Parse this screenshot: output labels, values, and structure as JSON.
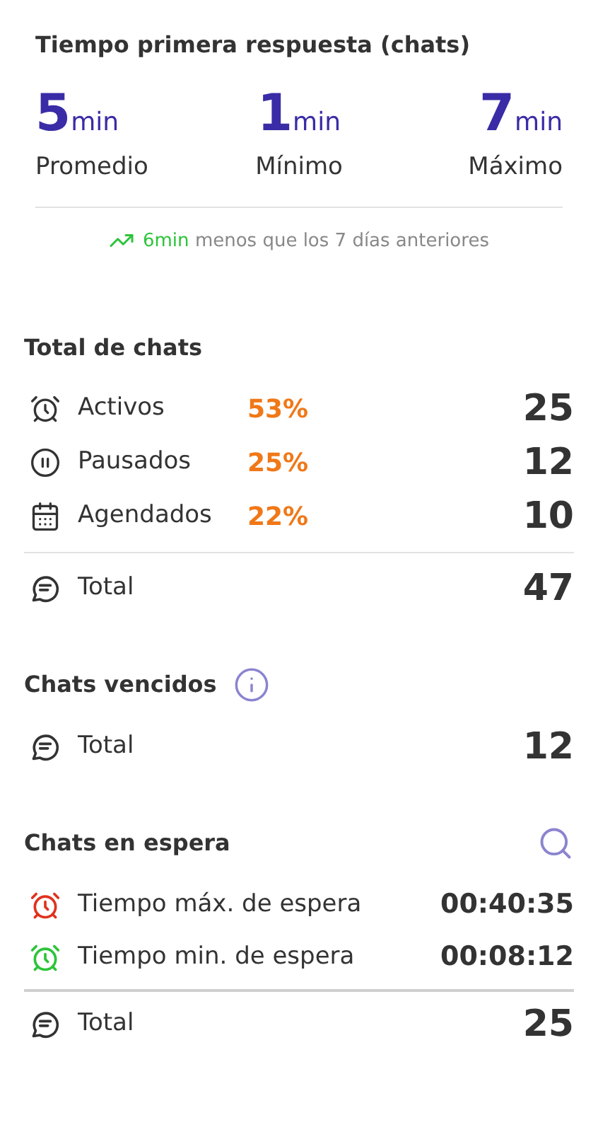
{
  "first_response": {
    "title": "Tiempo primera respuesta (chats)",
    "stats": [
      {
        "value": "5",
        "unit": "min",
        "label": "Promedio"
      },
      {
        "value": "1",
        "unit": "min",
        "label": "Mínimo"
      },
      {
        "value": "7",
        "unit": "min",
        "label": "Máximo"
      }
    ],
    "comparison": {
      "highlight": "6min",
      "text": "menos que los 7 días anteriores"
    }
  },
  "total_chats": {
    "title": "Total de chats",
    "rows": [
      {
        "kind": "alarm",
        "label": "Activos",
        "percent": "53%",
        "count": "25"
      },
      {
        "kind": "pause",
        "label": "Pausados",
        "percent": "25%",
        "count": "12"
      },
      {
        "kind": "calendar",
        "label": "Agendados",
        "percent": "22%",
        "count": "10"
      }
    ],
    "total": {
      "label": "Total",
      "count": "47"
    }
  },
  "overdue_chats": {
    "title": "Chats vencidos",
    "total": {
      "label": "Total",
      "count": "12"
    }
  },
  "waiting_chats": {
    "title": "Chats en espera",
    "rows": [
      {
        "label": "Tiempo máx. de espera",
        "value": "00:40:35",
        "color": "#e0321e"
      },
      {
        "label": "Tiempo min. de espera",
        "value": "00:08:12",
        "color": "#2cc43a"
      }
    ],
    "total": {
      "label": "Total",
      "count": "25"
    }
  }
}
